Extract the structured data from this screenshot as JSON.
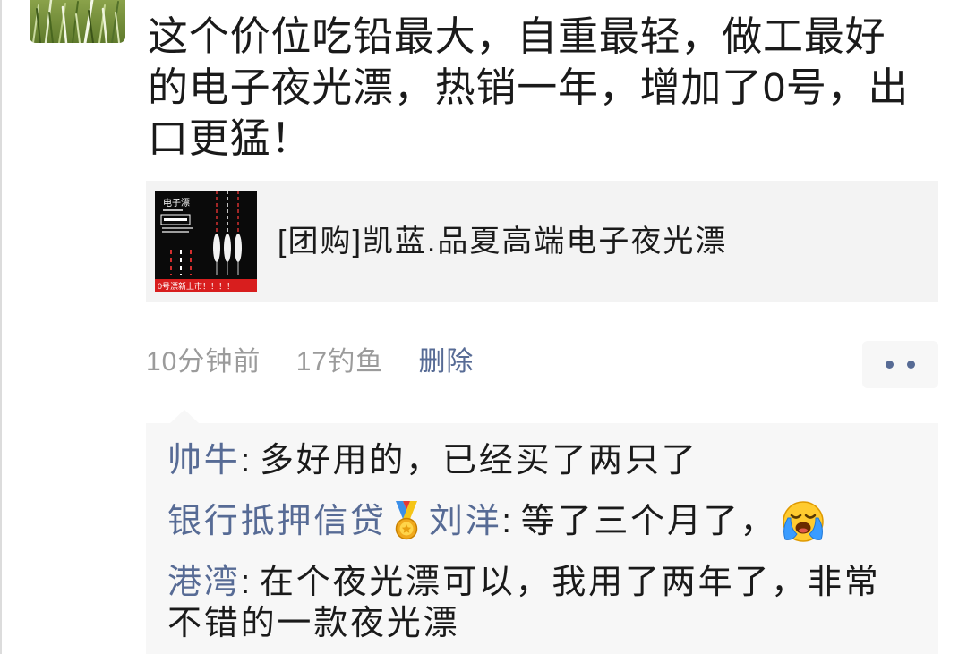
{
  "colors": {
    "link": "#576b95",
    "meta": "#9b9b9b",
    "text": "#1a1a1a",
    "card_bg": "#f3f3f3",
    "comment_bg": "#f7f7f7"
  },
  "avatar": {
    "icon": "avatar-grass-photo"
  },
  "post": {
    "text": "这个价位吃铅最大，自重最轻，做工最好的电子夜光漂，热销一年，增加了0号，出口更猛！"
  },
  "link_card": {
    "title": "[团购]凯蓝.品夏高端电子夜光漂",
    "thumbnail": {
      "heading": "电子漂",
      "banner": "0号漂新上市！！！！"
    }
  },
  "meta": {
    "time": "10分钟前",
    "source": "17钓鱼",
    "delete_label": "删除",
    "more_icon": "more-dots-icon"
  },
  "comments": [
    {
      "name": "帅牛",
      "separator": ":",
      "text": "多好用的，已经买了两只了"
    },
    {
      "name_prefix": "银行抵押信贷",
      "name_badge": "medal-icon",
      "name_suffix": "刘洋",
      "separator": ":",
      "text": "等了三个月了，",
      "emoji": "loudly-crying-face-icon"
    },
    {
      "name": "港湾",
      "separator": ":",
      "text": "在个夜光漂可以，我用了两年了，非常不错的一款夜光漂"
    }
  ]
}
